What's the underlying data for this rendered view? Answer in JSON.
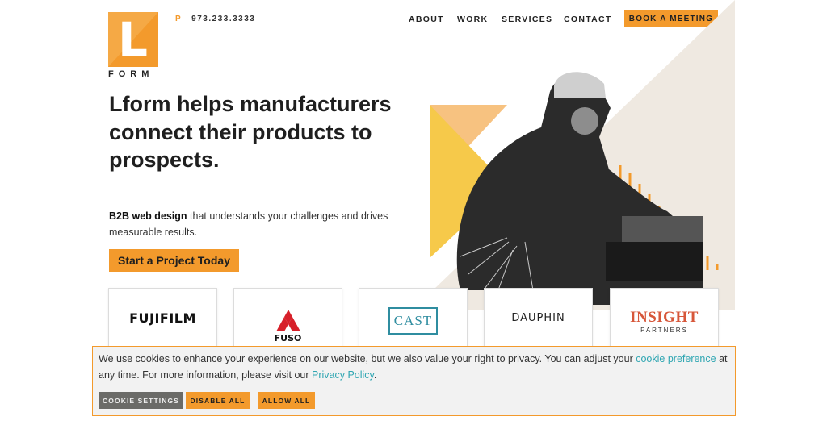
{
  "brand": {
    "logo_letter": "L",
    "wordmark": "FORM"
  },
  "header": {
    "phone_prefix": "P",
    "phone": "973.233.3333",
    "nav": [
      "ABOUT",
      "WORK",
      "SERVICES",
      "CONTACT"
    ],
    "cta": "BOOK A MEETING"
  },
  "hero": {
    "title": "Lform helps manufacturers connect their products to prospects.",
    "sub_bold": "B2B web design",
    "sub_rest": " that understands your challenges and drives measurable results.",
    "cta": "Start a Project Today"
  },
  "clients": [
    {
      "name": "FUJIFILM"
    },
    {
      "name": "FUSO"
    },
    {
      "name": "CAST"
    },
    {
      "name": "DAUPHIN"
    },
    {
      "name": "INSIGHT",
      "sub": "PARTNERS"
    }
  ],
  "cookie": {
    "text_1": "We use cookies to enhance your experience on our website, but we also value your right to privacy. You can adjust your ",
    "link_1": "cookie preference",
    "text_2": " at any time. For more information, please visit our ",
    "link_2": "Privacy Policy",
    "text_3": ".",
    "buttons": [
      "COOKIE SETTINGS",
      "DISABLE ALL",
      "ALLOW ALL"
    ]
  },
  "colors": {
    "accent": "#f39a2c",
    "teal": "#5ba9ac",
    "link": "#2fa6b2",
    "yellow": "#f6c94a",
    "beige": "#efe9e1"
  }
}
